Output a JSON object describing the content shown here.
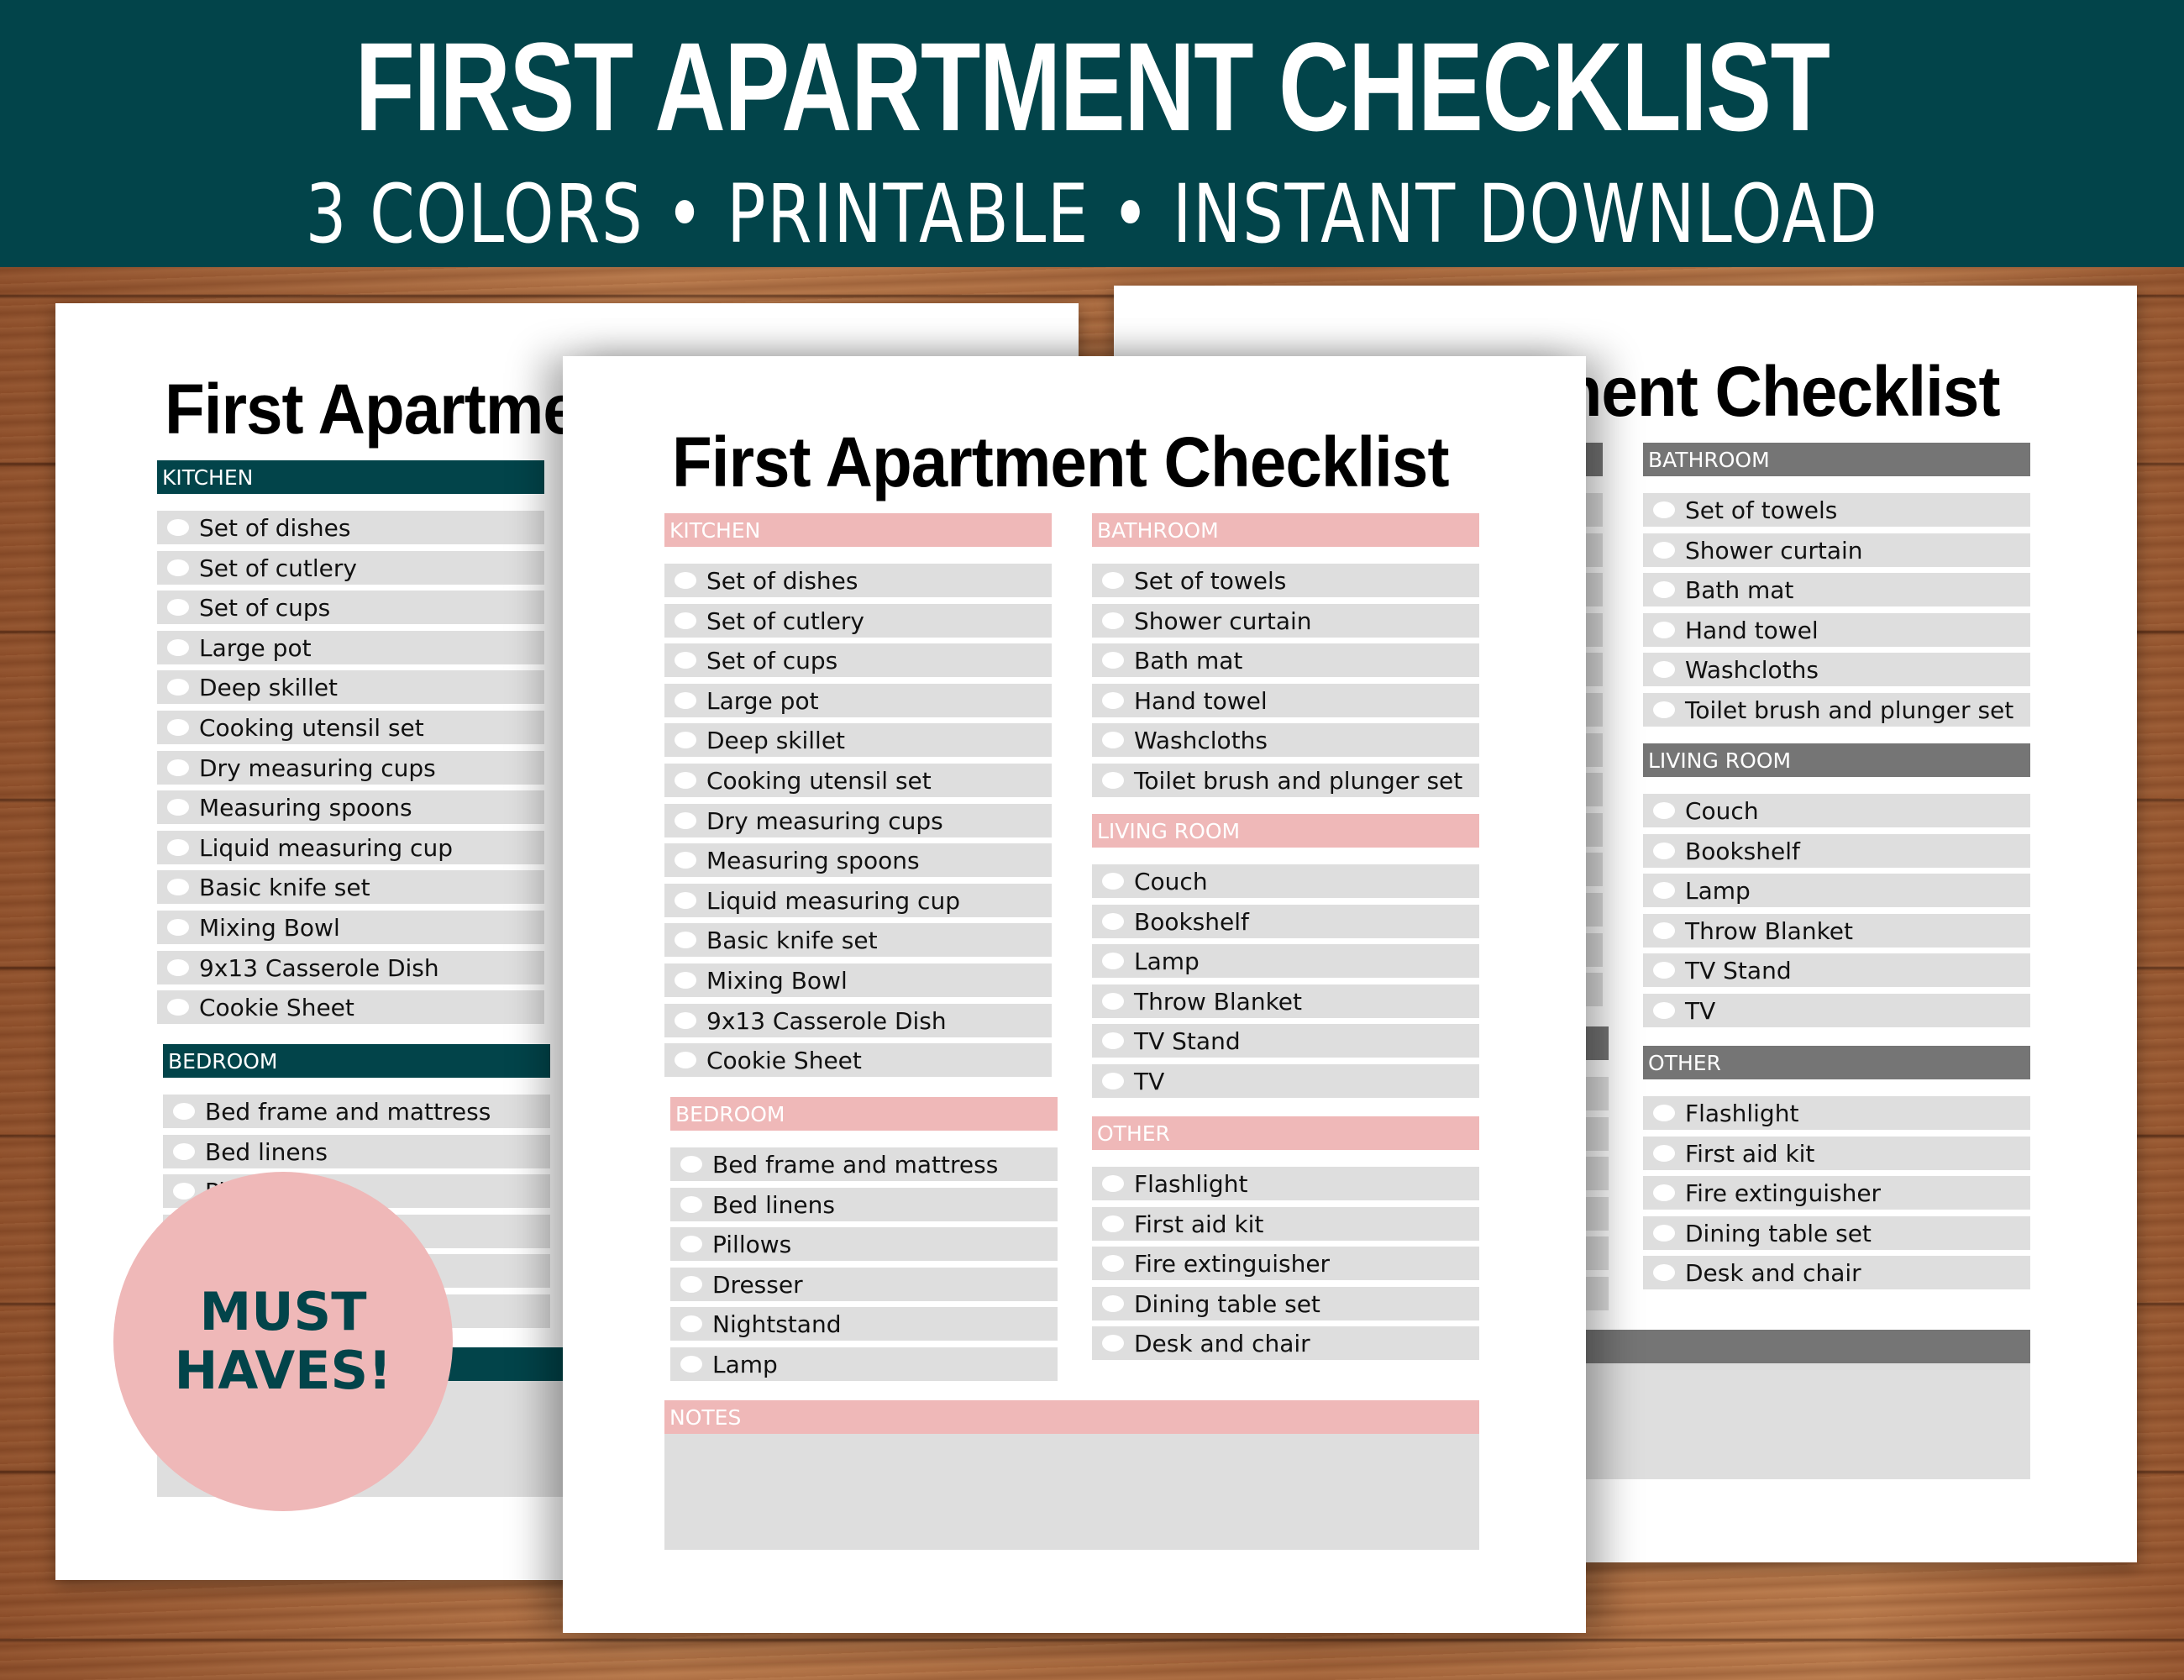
{
  "banner": {
    "title": "FIRST APARTMENT CHECKLIST",
    "subtitle": "3 COLORS • PRINTABLE • INSTANT DOWNLOAD"
  },
  "badge": {
    "line1": "MUST",
    "line2": "HAVES!"
  },
  "checklist": {
    "title": "First Apartment Checklist",
    "sections": {
      "kitchen": {
        "label": "KITCHEN",
        "items": [
          "Set of dishes",
          "Set of cutlery",
          "Set of cups",
          "Large pot",
          "Deep skillet",
          "Cooking utensil set",
          "Dry measuring cups",
          "Measuring spoons",
          "Liquid measuring cup",
          "Basic knife set",
          "Mixing Bowl",
          "9x13 Casserole Dish",
          "Cookie Sheet"
        ]
      },
      "bedroom": {
        "label": "BEDROOM",
        "items": [
          "Bed frame and mattress",
          "Bed linens",
          "Pillows",
          "Dresser",
          "Nightstand",
          "Lamp"
        ]
      },
      "bathroom": {
        "label": "BATHROOM",
        "items": [
          "Set of towels",
          "Shower curtain",
          "Bath mat",
          "Hand towel",
          "Washcloths",
          "Toilet brush and plunger set"
        ]
      },
      "living_room": {
        "label": "LIVING ROOM",
        "items": [
          "Couch",
          "Bookshelf",
          "Lamp",
          "Throw Blanket",
          "TV Stand",
          "TV"
        ]
      },
      "other": {
        "label": "OTHER",
        "items": [
          "Flashlight",
          "First aid kit",
          "Fire extinguisher",
          "Dining table set",
          "Desk and chair"
        ]
      },
      "notes": {
        "label": "NOTES"
      }
    }
  },
  "colors": {
    "banner": "#02444a",
    "teal_theme": "#02444a",
    "pink_theme": "#efb8b8",
    "gray_theme": "#757575",
    "row": "#dedede"
  },
  "pages": [
    {
      "id": "page-left",
      "theme": "teal",
      "header_color": "#02444a"
    },
    {
      "id": "page-right",
      "theme": "gray",
      "header_color": "#757575"
    },
    {
      "id": "page-center",
      "theme": "pink",
      "header_color": "#efb8b8"
    }
  ]
}
